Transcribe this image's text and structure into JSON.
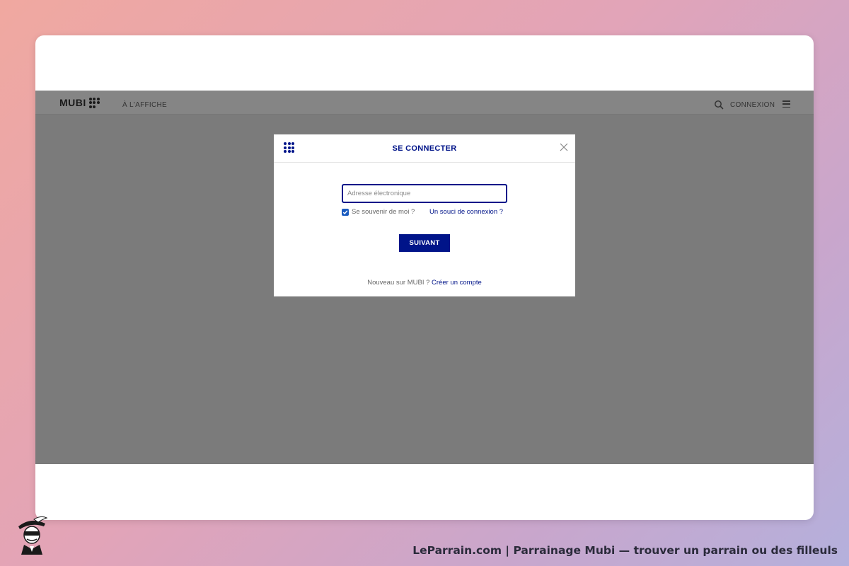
{
  "site": {
    "logo_text": "MUBI",
    "nav_item": "À L'AFFICHE",
    "connexion_label": "CONNEXION"
  },
  "modal": {
    "title": "SE CONNECTER",
    "email_placeholder": "Adresse électronique",
    "email_value": "",
    "remember_label": "Se souvenir de moi ?",
    "remember_checked": true,
    "trouble_link": "Un souci de connexion ?",
    "next_button": "SUIVANT",
    "new_prompt": "Nouveau sur MUBI ?",
    "create_account_link": "Créer un compte"
  },
  "caption": "LeParrain.com | Parrainage Mubi — trouver un parrain ou des filleuls",
  "icons": [
    "mubi-dots-icon",
    "search-icon",
    "menu-icon",
    "close-icon",
    "checkmark-icon",
    "mascot-icon"
  ],
  "colors": {
    "brand": "#001489",
    "overlay": "#7b7b7b",
    "checkbox": "#1a5bbf"
  }
}
